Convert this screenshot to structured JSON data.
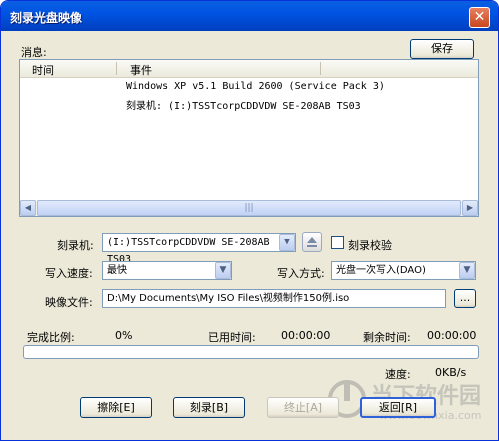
{
  "window": {
    "title": "刻录光盘映像",
    "close_glyph": "✕"
  },
  "messages": {
    "label": "消息:",
    "save_label": "保存",
    "columns": {
      "time": "时间",
      "event": "事件"
    },
    "rows": [
      {
        "time": "",
        "event": "Windows XP v5.1 Build 2600 (Service Pack 3)"
      },
      {
        "time": "",
        "event": "刻录机:  (I:)TSSTcorpCDDVDW SE-208AB TS03"
      }
    ]
  },
  "recorder": {
    "label": "刻录机:",
    "value": "(I:)TSSTcorpCDDVDW SE-208AB TS03",
    "verify_label": "刻录校验",
    "verify_checked": false
  },
  "speed": {
    "label": "写入速度:",
    "value": "最快"
  },
  "method": {
    "label": "写入方式:",
    "value": "光盘一次写入(DAO)"
  },
  "image": {
    "label": "映像文件:",
    "path": "D:\\My Documents\\My ISO Files\\视频制作150例.iso",
    "browse_label": "..."
  },
  "status": {
    "completion_label": "完成比例:",
    "completion_value": "0%",
    "elapsed_label": "已用时间:",
    "elapsed_value": "00:00:00",
    "remaining_label": "剩余时间:",
    "remaining_value": "00:00:00",
    "speed_label": "速度:",
    "speed_value": "0KB/s",
    "progress_fraction": 0
  },
  "buttons": {
    "erase": "擦除[E]",
    "burn": "刻录[B]",
    "stop": "终止[A]",
    "back": "返回[R]"
  },
  "watermark": {
    "text": "当下软件园",
    "url": "www.downxia.com"
  },
  "colors": {
    "title_bar": "#0054e3",
    "face": "#ece9d8",
    "border": "#7f9db9",
    "close": "#c8461f"
  }
}
